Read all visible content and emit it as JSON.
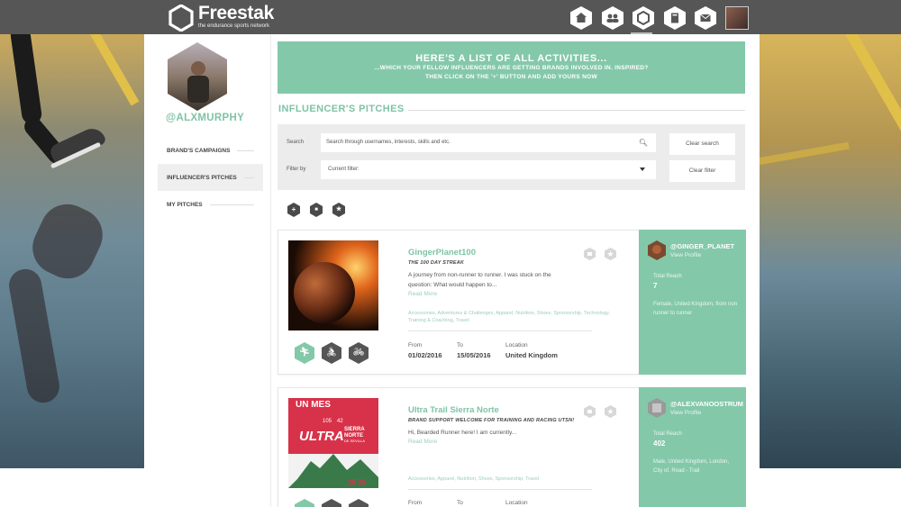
{
  "app": {
    "logo_name": "Freestak",
    "logo_tagline": "the endurance sports network"
  },
  "nav": {
    "items": [
      {
        "name": "home-icon"
      },
      {
        "name": "community-icon"
      },
      {
        "name": "pitches-icon",
        "active": true
      },
      {
        "name": "book-icon"
      },
      {
        "name": "mail-icon"
      },
      {
        "name": "user-avatar"
      }
    ]
  },
  "sidebar": {
    "username": "@ALXMURPHY",
    "items": [
      {
        "label": "BRAND'S CAMPAIGNS"
      },
      {
        "label": "INFLUENCER'S PITCHES",
        "active": true
      },
      {
        "label": "MY PITCHES"
      }
    ]
  },
  "banner": {
    "title": "HERE'S A LIST OF ALL ACTIVITIES...",
    "line1": "...WHICH YOUR FELLOW INFLUENCERS ARE GETTING BRANDS INVOLVED IN. INSPIRED?",
    "line2": "THEN CLICK ON THE '+' BUTTON AND ADD YOURS NOW"
  },
  "section_title": "INFLUENCER'S PITCHES",
  "search": {
    "search_label": "Search",
    "placeholder": "Search through usernames, interests, skills and etc.",
    "filter_label": "Filter by",
    "filter_value": "Current filter:",
    "clear_search": "Clear search",
    "clear_filter": "Clear filter"
  },
  "tools": [
    {
      "name": "add-pitch-icon",
      "glyph": "+"
    },
    {
      "name": "folder-icon",
      "glyph": "■"
    },
    {
      "name": "star-icon",
      "glyph": "★"
    }
  ],
  "meta_labels": {
    "from": "From",
    "to": "To",
    "location": "Location"
  },
  "pitches": [
    {
      "title": "GingerPlanet100",
      "subtitle": "THE 100 DAY STREAK",
      "description": "A journey from non-runner to runner. I was stuck on the question: What would happen to...",
      "read_more": "Read More",
      "tags": "Accessories, Adventures & Challenges, Apparel, Nutrition, Shoes, Sponsorship, Technology, Training & Coaching, Travel",
      "from": "01/02/2016",
      "to": "15/05/2016",
      "location": "United Kingdom",
      "sports": [
        "running-icon",
        "cycling-icon",
        "bike-icon"
      ],
      "influencer": {
        "handle": "@GINGER_PLANET",
        "view_profile": "View Profile",
        "reach_label": "Total Reach",
        "reach": "7",
        "description": "Female, United Kingdom, from non runner to runner"
      }
    },
    {
      "title": "Ultra Trail Sierra Norte",
      "subtitle": "BRAND SUPPORT WELCOME FOR TRAINING AND RACING UTSN!",
      "description": "Hi, Bearded Runner here! I am currently...",
      "read_more": "Read More",
      "tags": "Accessories, Apparel, Nutrition, Shoes, Sponsorship, Travel",
      "from": "",
      "to": "",
      "location": "",
      "sports": [
        "running-icon",
        "cycling-icon",
        "bike-icon"
      ],
      "poster": {
        "top": "UN MES",
        "n1": "105",
        "n2": "42",
        "big": "ULTRA",
        "side1": "SIERRA",
        "side2": "NORTE",
        "side3": "DE SEVILLA",
        "date": "28 29"
      },
      "influencer": {
        "handle": "@ALEXVANOOSTRUM",
        "view_profile": "View Profile",
        "reach_label": "Total Reach",
        "reach": "402",
        "description": "Male, United Kingdom, London, City of, Road - Trail"
      }
    }
  ]
}
